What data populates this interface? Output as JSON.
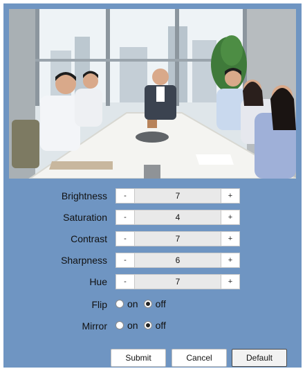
{
  "preview": {
    "icon": "video-preview-image"
  },
  "settings": [
    {
      "key": "brightness",
      "label": "Brightness",
      "value": "7",
      "minus": "-",
      "plus": "+"
    },
    {
      "key": "saturation",
      "label": "Saturation",
      "value": "4",
      "minus": "-",
      "plus": "+"
    },
    {
      "key": "contrast",
      "label": "Contrast",
      "value": "7",
      "minus": "-",
      "plus": "+"
    },
    {
      "key": "sharpness",
      "label": "Sharpness",
      "value": "6",
      "minus": "-",
      "plus": "+"
    },
    {
      "key": "hue",
      "label": "Hue",
      "value": "7",
      "minus": "-",
      "plus": "+"
    }
  ],
  "flip": {
    "label": "Flip",
    "on": "on",
    "off": "off",
    "selected": "off"
  },
  "mirror": {
    "label": "Mirror",
    "on": "on",
    "off": "off",
    "selected": "off"
  },
  "buttons": {
    "submit": "Submit",
    "cancel": "Cancel",
    "default": "Default"
  },
  "colors": {
    "panel": "#6f95c2",
    "value_bg": "#e9e9e9"
  }
}
